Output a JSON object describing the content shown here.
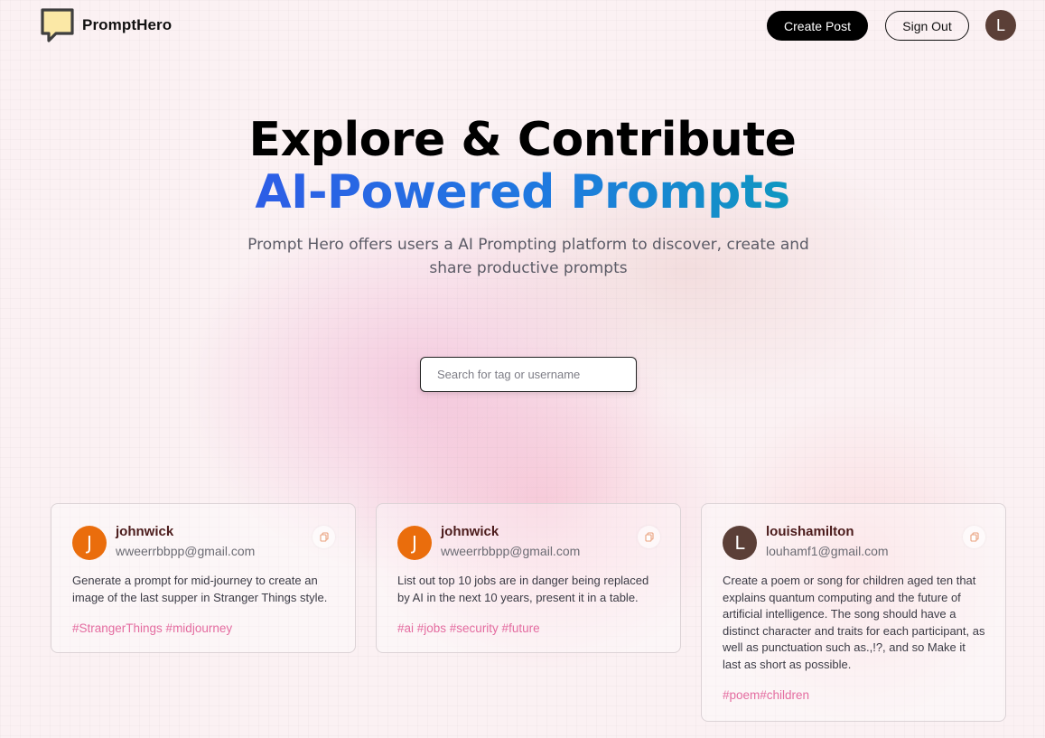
{
  "nav": {
    "brand": "PromptHero",
    "create_post": "Create Post",
    "sign_out": "Sign Out",
    "avatar_initial": "L"
  },
  "hero": {
    "title_line1": "Explore & Contribute",
    "title_line2": "AI-Powered Prompts",
    "description": "Prompt Hero offers users a AI Prompting platform to discover, create and share productive prompts"
  },
  "search": {
    "placeholder": "Search for tag or username",
    "value": ""
  },
  "posts": [
    {
      "avatar_initial": "J",
      "avatar_color": "#ea6d0c",
      "username": "johnwick",
      "email": "wweerrbbpp@gmail.com",
      "prompt": "Generate a prompt for mid-journey to create an image of the last supper in Stranger Things style.",
      "tags": "#StrangerThings #midjourney"
    },
    {
      "avatar_initial": "J",
      "avatar_color": "#ea6d0c",
      "username": "johnwick",
      "email": "wweerrbbpp@gmail.com",
      "prompt": "List out top 10 jobs are in danger being replaced by AI in the next 10 years, present it in a table.",
      "tags": "#ai #jobs #security #future"
    },
    {
      "avatar_initial": "L",
      "avatar_color": "#5b3f37",
      "username": "louishamilton",
      "email": "louhamf1@gmail.com",
      "prompt": "Create a poem or song for children aged ten that explains quantum computing and the future of artificial intelligence. The song should have a distinct character and traits for each participant, as well as punctuation such as.,!?, and so Make it last as short as possible.",
      "tags": "#poem#children"
    }
  ],
  "colors": {
    "gradient_start": "#2d5de6",
    "gradient_end": "#0f97c0",
    "tag": "#e46ca0",
    "username": "#4b1b1b"
  },
  "icons": {
    "logo": "speech-bubble-icon",
    "copy": "copy-icon"
  }
}
